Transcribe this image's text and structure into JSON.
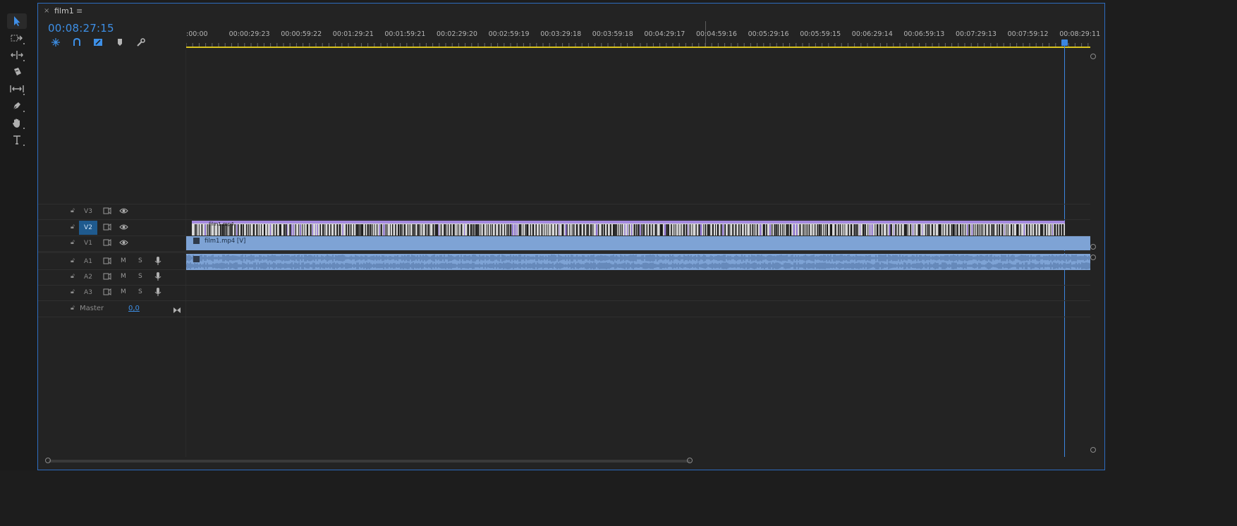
{
  "tab": {
    "close": "×",
    "title": "film1",
    "menu": "≡"
  },
  "timecode": "00:08:27:15",
  "ruler": {
    "labels": [
      ":00:00",
      "00:00:29:23",
      "00:00:59:22",
      "00:01:29:21",
      "00:01:59:21",
      "00:02:29:20",
      "00:02:59:19",
      "00:03:29:18",
      "00:03:59:18",
      "00:04:29:17",
      "00:04:59:16",
      "00:05:29:16",
      "00:05:59:15",
      "00:06:29:14",
      "00:06:59:13",
      "00:07:29:13",
      "00:07:59:12",
      "00:08:29:11"
    ]
  },
  "tracks": {
    "video": [
      {
        "name": "V3",
        "active": false
      },
      {
        "name": "V2",
        "active": true
      },
      {
        "name": "V1",
        "active": false
      }
    ],
    "audio": [
      {
        "name": "A1",
        "m": "M",
        "s": "S"
      },
      {
        "name": "A2",
        "m": "M",
        "s": "S"
      },
      {
        "name": "A3",
        "m": "M",
        "s": "S"
      }
    ],
    "master": {
      "name": "Master",
      "value": "0,0"
    }
  },
  "clips": {
    "v1_label": "film1.mp4 [V]",
    "v2_label": "film1.mp4"
  },
  "colors": {
    "accent": "#3d8fe6",
    "clip": "#7ea3d5",
    "work_area": "#d9c41e"
  },
  "tools": [
    "selection-tool",
    "track-select-tool",
    "ripple-edit-tool",
    "razor-tool",
    "slip-tool",
    "pen-tool",
    "hand-tool",
    "type-tool"
  ]
}
